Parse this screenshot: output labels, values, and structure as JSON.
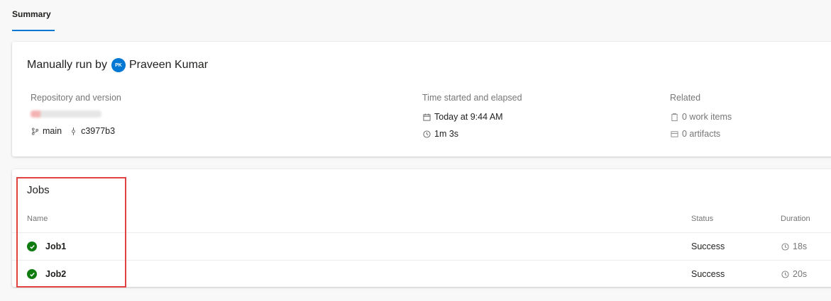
{
  "tabs": {
    "summary_label": "Summary"
  },
  "run": {
    "prefix": "Manually run by",
    "avatar_initials": "PK",
    "user_name": "Praveen Kumar"
  },
  "repository": {
    "label": "Repository and version",
    "branch": "main",
    "commit": "c3977b3"
  },
  "time": {
    "label": "Time started and elapsed",
    "started": "Today at 9:44 AM",
    "elapsed": "1m 3s"
  },
  "related": {
    "label": "Related",
    "work_items": "0 work items",
    "artifacts": "0 artifacts"
  },
  "jobs": {
    "title": "Jobs",
    "columns": {
      "name": "Name",
      "status": "Status",
      "duration": "Duration"
    },
    "rows": [
      {
        "name": "Job1",
        "status": "Success",
        "duration": "18s"
      },
      {
        "name": "Job2",
        "status": "Success",
        "duration": "20s"
      }
    ]
  },
  "colors": {
    "accent": "#0078d4",
    "success": "#107c10",
    "highlight": "#e04141"
  }
}
